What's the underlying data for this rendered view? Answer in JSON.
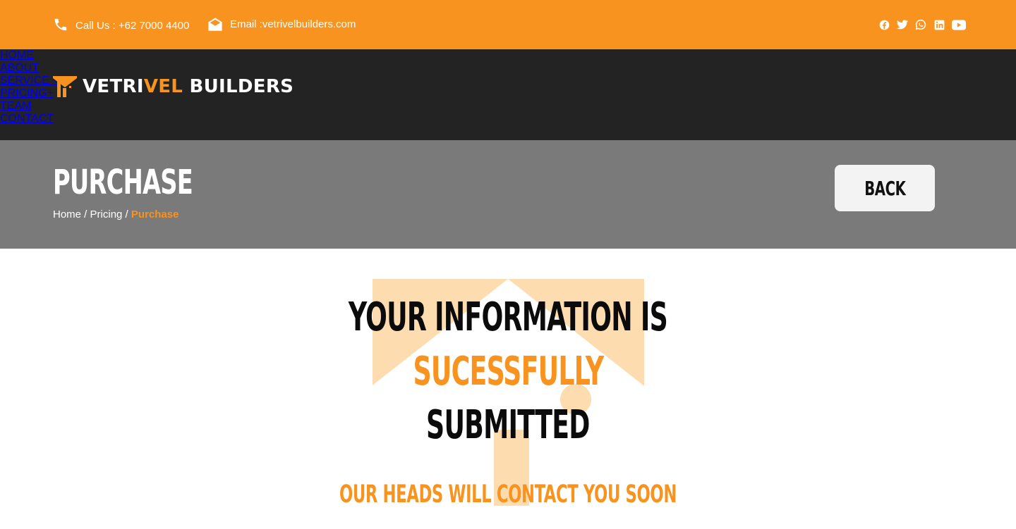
{
  "topbar": {
    "phone_text": "Call Us : +62 7000 4400",
    "email_text": "Email :vetrivelbuilders.com",
    "icons": [
      "phone-icon",
      "envelope-open-icon"
    ],
    "social": [
      "facebook-icon",
      "twitter-icon",
      "whatsapp-icon",
      "linkedin-icon",
      "youtube-icon"
    ],
    "background": "#f7931e"
  },
  "nav": {
    "logo_part1": "VETRI",
    "logo_part2": "VEL",
    "logo_part3": " BUILDERS",
    "items": [
      {
        "label": "HOME"
      },
      {
        "label": "ABOUT"
      },
      {
        "label": "SERVICE +"
      },
      {
        "label": "PRICING+"
      },
      {
        "label": "TEAM"
      },
      {
        "label": "CONTACT"
      }
    ],
    "background": "#232323"
  },
  "page_header": {
    "title": "PURCHASE",
    "breadcrumb": {
      "home": "Home",
      "sep1": " / ",
      "pricing": "Pricing",
      "sep2": " / ",
      "current": "Purchase"
    },
    "back_label": "BACK",
    "background": "#7a7a7a"
  },
  "content": {
    "line1": "YOUR INFORMATION IS",
    "line2": "SUCESSFULLY",
    "line3": "SUBMITTED",
    "line4": "OUR HEADS WILL CONTACT YOU SOON",
    "accent": "#f7931e",
    "illustration_color": "#fddcb0"
  }
}
